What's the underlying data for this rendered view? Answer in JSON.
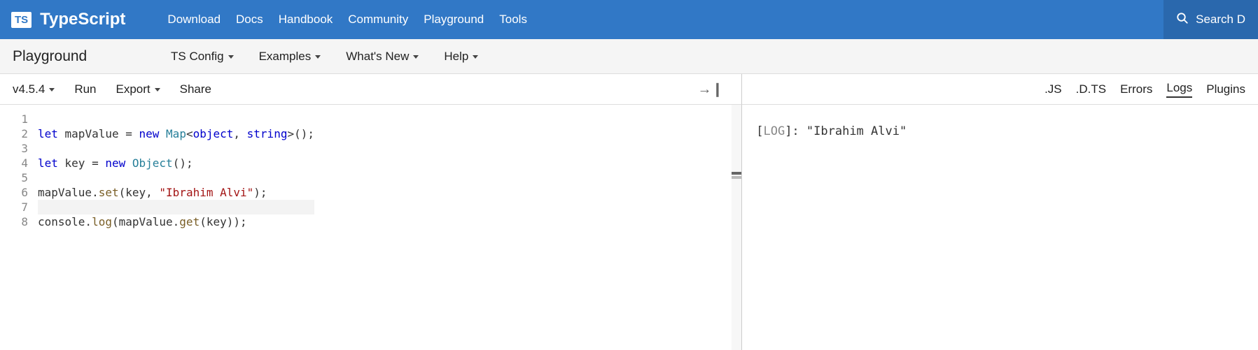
{
  "brand": {
    "logo": "TS",
    "name": "TypeScript"
  },
  "topnav": {
    "items": [
      "Download",
      "Docs",
      "Handbook",
      "Community",
      "Playground",
      "Tools"
    ],
    "search_label": "Search D"
  },
  "subnav": {
    "title": "Playground",
    "items": [
      "TS Config",
      "Examples",
      "What's New",
      "Help"
    ]
  },
  "toolbar": {
    "version": "v4.5.4",
    "run": "Run",
    "export": "Export",
    "share": "Share"
  },
  "editor": {
    "line_numbers": [
      "1",
      "2",
      "3",
      "4",
      "5",
      "6",
      "7",
      "8"
    ],
    "lines": [
      {
        "tokens": []
      },
      {
        "tokens": [
          {
            "t": "kw",
            "v": "let"
          },
          {
            "t": "plain",
            "v": " mapValue = "
          },
          {
            "t": "kw",
            "v": "new"
          },
          {
            "t": "plain",
            "v": " "
          },
          {
            "t": "type",
            "v": "Map"
          },
          {
            "t": "plain",
            "v": "<"
          },
          {
            "t": "typekw",
            "v": "object"
          },
          {
            "t": "plain",
            "v": ", "
          },
          {
            "t": "typekw",
            "v": "string"
          },
          {
            "t": "plain",
            "v": ">();"
          }
        ]
      },
      {
        "tokens": []
      },
      {
        "tokens": [
          {
            "t": "kw",
            "v": "let"
          },
          {
            "t": "plain",
            "v": " key = "
          },
          {
            "t": "kw",
            "v": "new"
          },
          {
            "t": "plain",
            "v": " "
          },
          {
            "t": "type",
            "v": "Object"
          },
          {
            "t": "plain",
            "v": "();"
          }
        ]
      },
      {
        "tokens": []
      },
      {
        "tokens": [
          {
            "t": "plain",
            "v": "mapValue."
          },
          {
            "t": "fn",
            "v": "set"
          },
          {
            "t": "plain",
            "v": "(key, "
          },
          {
            "t": "str",
            "v": "\"Ibrahim Alvi\""
          },
          {
            "t": "plain",
            "v": ");"
          }
        ]
      },
      {
        "tokens": [],
        "current": true
      },
      {
        "tokens": [
          {
            "t": "plain",
            "v": "console."
          },
          {
            "t": "fn",
            "v": "log"
          },
          {
            "t": "plain",
            "v": "(mapValue."
          },
          {
            "t": "fn",
            "v": "get"
          },
          {
            "t": "plain",
            "v": "(key));"
          }
        ]
      }
    ]
  },
  "output": {
    "tabs": [
      ".JS",
      ".D.TS",
      "Errors",
      "Logs",
      "Plugins"
    ],
    "active_tab": 3,
    "log_prefix": "[",
    "log_tag": "LOG",
    "log_suffix": "]: ",
    "log_value": "\"Ibrahim Alvi\""
  }
}
